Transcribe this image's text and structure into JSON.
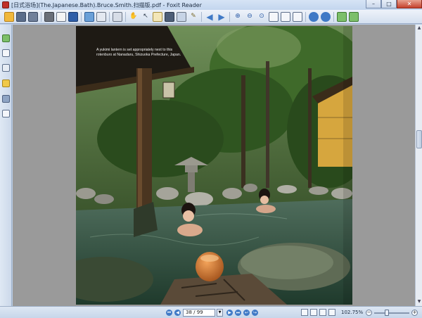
{
  "window": {
    "title": "[日式浴场](The.Japanese.Bath).Bruce.Smith.扫描版.pdf - Foxit Reader",
    "controls": {
      "minimize": "–",
      "maximize": "□",
      "close": "✕"
    }
  },
  "toolbar": {
    "icons": [
      "open-icon",
      "save-icon",
      "save-as-icon",
      "print-icon",
      "email-icon",
      "document-properties-icon",
      "typewriter-icon",
      "comment-icon",
      "page-layout-icon",
      "hand-tool-icon",
      "select-tool-icon",
      "text-select-icon",
      "snapshot-icon",
      "image-select-icon",
      "pen-icon",
      "previous-view-icon",
      "next-view-icon",
      "zoom-in-tool-icon",
      "zoom-out-icon",
      "actual-size-icon",
      "fit-page-icon",
      "fit-width-icon",
      "fit-visible-icon",
      "rotate-left-icon",
      "rotate-right-icon",
      "page-up-icon",
      "page-down-icon"
    ]
  },
  "sidebar": {
    "icons": [
      "bookmarks-icon",
      "pages-icon",
      "layers-icon",
      "comments-icon",
      "attachments-icon",
      "signatures-icon"
    ]
  },
  "document": {
    "caption": "A yukimi lantern is set appropriately next to this rotenburo at Nanadaru, Shizuoka Prefecture, Japan."
  },
  "status": {
    "page_display": "38 / 99",
    "zoom": "102.75%",
    "zoom_fraction": 0.35
  },
  "colors": {
    "chrome": "#d4e0ef",
    "doc_background": "#9a9a9a",
    "accent": "#3f79c6"
  }
}
